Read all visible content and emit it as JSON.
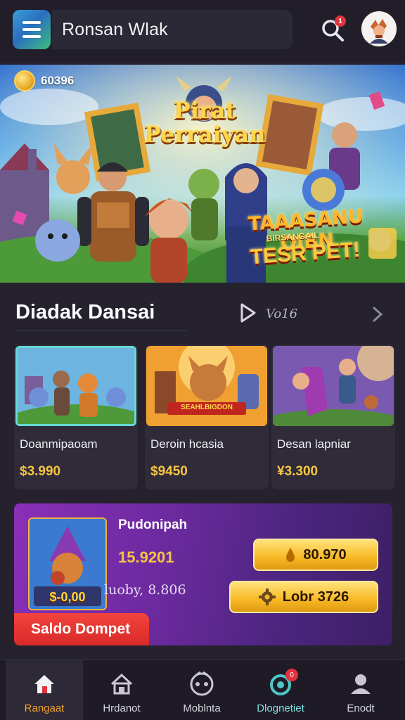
{
  "header": {
    "title": "Ronsan Wlak",
    "notification_count": "1"
  },
  "hero": {
    "coins": "60396",
    "title_line1": "Pirat",
    "title_line2": "Perraiyan",
    "promo_line1": "TAAASANU OIBN",
    "promo_line2": "BIRSANGAIL",
    "promo_line3": "TESR PET!"
  },
  "section": {
    "title": "Diadak Dansai",
    "view_label": "Vo16"
  },
  "cards": [
    {
      "name": "Doanmipaoam",
      "price": "$3.990",
      "selected": true
    },
    {
      "name": "Deroin hcasia",
      "price": "$9450",
      "selected": false,
      "banner": "SEAHLBIGDON"
    },
    {
      "name": "Desan lapniar",
      "price": "¥3.300",
      "selected": false
    }
  ],
  "wallet": {
    "title": "Pudonipah",
    "amount": "15.9201",
    "sub": "luoby, 8.806",
    "thumb_label": "$-0,00",
    "button1_label": "80.970",
    "button2_label": "Lobr 3726",
    "tab_label": "Saldo Dompet"
  },
  "nav": {
    "items": [
      {
        "label": "Rangaat",
        "icon": "home-icon",
        "active": true
      },
      {
        "label": "Hrdanot",
        "icon": "house-icon",
        "active": false
      },
      {
        "label": "Moblnta",
        "icon": "gamepad-icon",
        "active": false
      },
      {
        "label": "Dlognetiet",
        "icon": "alert-icon",
        "active": false,
        "badge": "0"
      },
      {
        "label": "Enodt",
        "icon": "user-icon",
        "active": false
      }
    ]
  },
  "colors": {
    "background": "#25222e",
    "accent_gold": "#f6c544",
    "accent_red": "#e0333b",
    "accent_teal": "#66d9d6",
    "wallet_purple": "#6b2a9e"
  }
}
